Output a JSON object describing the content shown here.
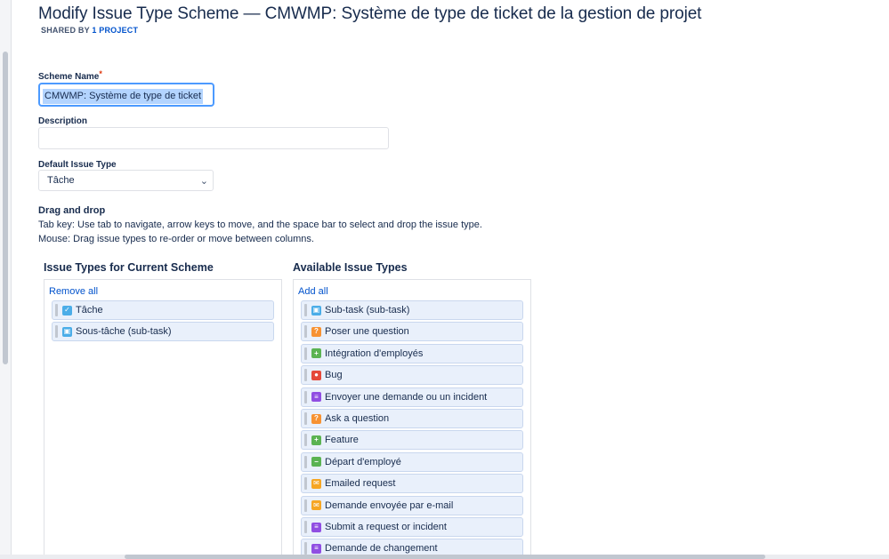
{
  "header": {
    "title": "Modify Issue Type Scheme — CMWMP: Système de type de ticket de la gestion de projet",
    "shared_by_label": "SHARED BY",
    "shared_by_count": "1 PROJECT"
  },
  "form": {
    "scheme_name_label": "Scheme Name",
    "required_mark": "*",
    "scheme_name_value": "CMWMP: Système de type de ticket",
    "description_label": "Description",
    "description_value": "",
    "default_issue_type_label": "Default Issue Type",
    "default_issue_type_value": "Tâche"
  },
  "drag_drop": {
    "title": "Drag and drop",
    "keyboard_help": "Tab key: Use tab to navigate, arrow keys to move, and the space bar to select and drop the issue type.",
    "mouse_help": "Mouse: Drag issue types to re-order or move between columns."
  },
  "current_scheme": {
    "title": "Issue Types for Current Scheme",
    "action_label": "Remove all",
    "items": [
      {
        "label": "Tâche",
        "icon": "task-checkbox-icon",
        "color": "#4bade8"
      },
      {
        "label": "Sous-tâche (sub-task)",
        "icon": "subtask-icon",
        "color": "#4bade8"
      }
    ]
  },
  "available": {
    "title": "Available Issue Types",
    "action_label": "Add all",
    "items": [
      {
        "label": "Sub-task (sub-task)",
        "icon": "subtask-icon",
        "color": "#4bade8"
      },
      {
        "label": "Poser une question",
        "icon": "question-icon",
        "color": "#f79232"
      },
      {
        "label": "Intégration d'employés",
        "icon": "plus-icon",
        "color": "#5bb352"
      },
      {
        "label": "Bug",
        "icon": "bug-icon",
        "color": "#e5493a"
      },
      {
        "label": "Envoyer une demande ou un incident",
        "icon": "lines-icon",
        "color": "#904ee2"
      },
      {
        "label": "Ask a question",
        "icon": "question-icon",
        "color": "#f79232"
      },
      {
        "label": "Feature",
        "icon": "plus-icon",
        "color": "#5bb352"
      },
      {
        "label": "Départ d'employé",
        "icon": "minus-icon",
        "color": "#5bb352"
      },
      {
        "label": "Emailed request",
        "icon": "envelope-icon",
        "color": "#f6a623"
      },
      {
        "label": "Demande envoyée par e-mail",
        "icon": "envelope-icon",
        "color": "#f6a623"
      },
      {
        "label": "Submit a request or incident",
        "icon": "lines-icon",
        "color": "#904ee2"
      },
      {
        "label": "Demande de changement",
        "icon": "lines-icon",
        "color": "#904ee2"
      }
    ]
  }
}
